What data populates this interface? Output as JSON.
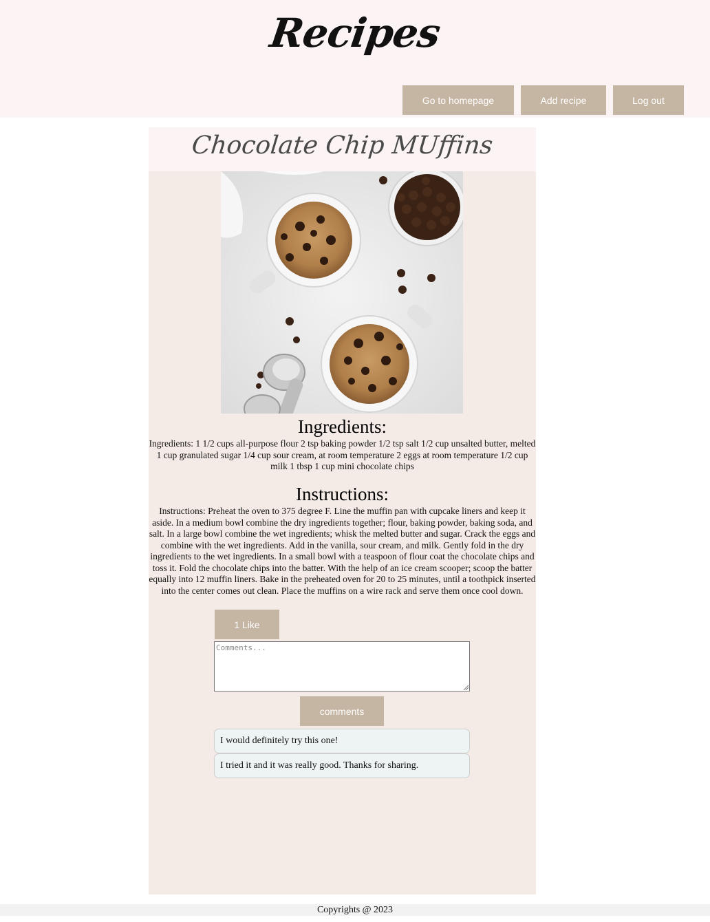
{
  "header": {
    "site_title": "Recipes",
    "nav": {
      "homepage_label": "Go to homepage",
      "add_recipe_label": "Add recipe",
      "logout_label": "Log out"
    }
  },
  "recipe": {
    "title": "Chocolate Chip MUffins",
    "image_subject": "chocolate chip muffins in white mugs with a bowl of chocolate chips and scoops",
    "ingredients_heading": "Ingredients:",
    "ingredients_text": "Ingredients: 1 1/2 cups all-purpose flour 2 tsp baking powder 1/2 tsp salt 1/2 cup unsalted butter, melted 1 cup granulated sugar 1/4 cup sour cream, at room temperature 2 eggs at room temperature 1/2 cup milk 1 tbsp 1 cup mini chocolate chips",
    "instructions_heading": "Instructions:",
    "instructions_text": "Instructions: Preheat the oven to 375 degree F. Line the muffin pan with cupcake liners and keep it aside. In a medium bowl combine the dry ingredients together; flour, baking powder, baking soda, and salt. In a large bowl combine the wet ingredients; whisk the melted butter and sugar. Crack the eggs and combine with the wet ingredients. Add in the vanilla, sour cream, and milk. Gently fold in the dry ingredients to the wet ingredients. In a small bowl with a teaspoon of flour coat the chocolate chips and toss it. Fold the chocolate chips into the batter. With the help of an ice cream scooper; scoop the batter equally into 12 muffin liners. Bake in the preheated oven for 20 to 25 minutes, until a toothpick inserted into the center comes out clean. Place the muffins on a wire rack and serve them once cool down."
  },
  "interactions": {
    "like_label": "1 Like",
    "comment_placeholder": "Comments...",
    "comment_value": "",
    "submit_comment_label": "comments"
  },
  "comments": [
    {
      "text": "I would definitely try this one!"
    },
    {
      "text": "I tried it and it was really good. Thanks for sharing."
    }
  ],
  "footer": {
    "copyright": "Copyrights @ 2023"
  },
  "colors": {
    "header_bg": "#fcf4f4",
    "card_bg": "#f5ebe6",
    "button_bg": "#c5b5a3",
    "comment_bg": "#eef4f3"
  }
}
